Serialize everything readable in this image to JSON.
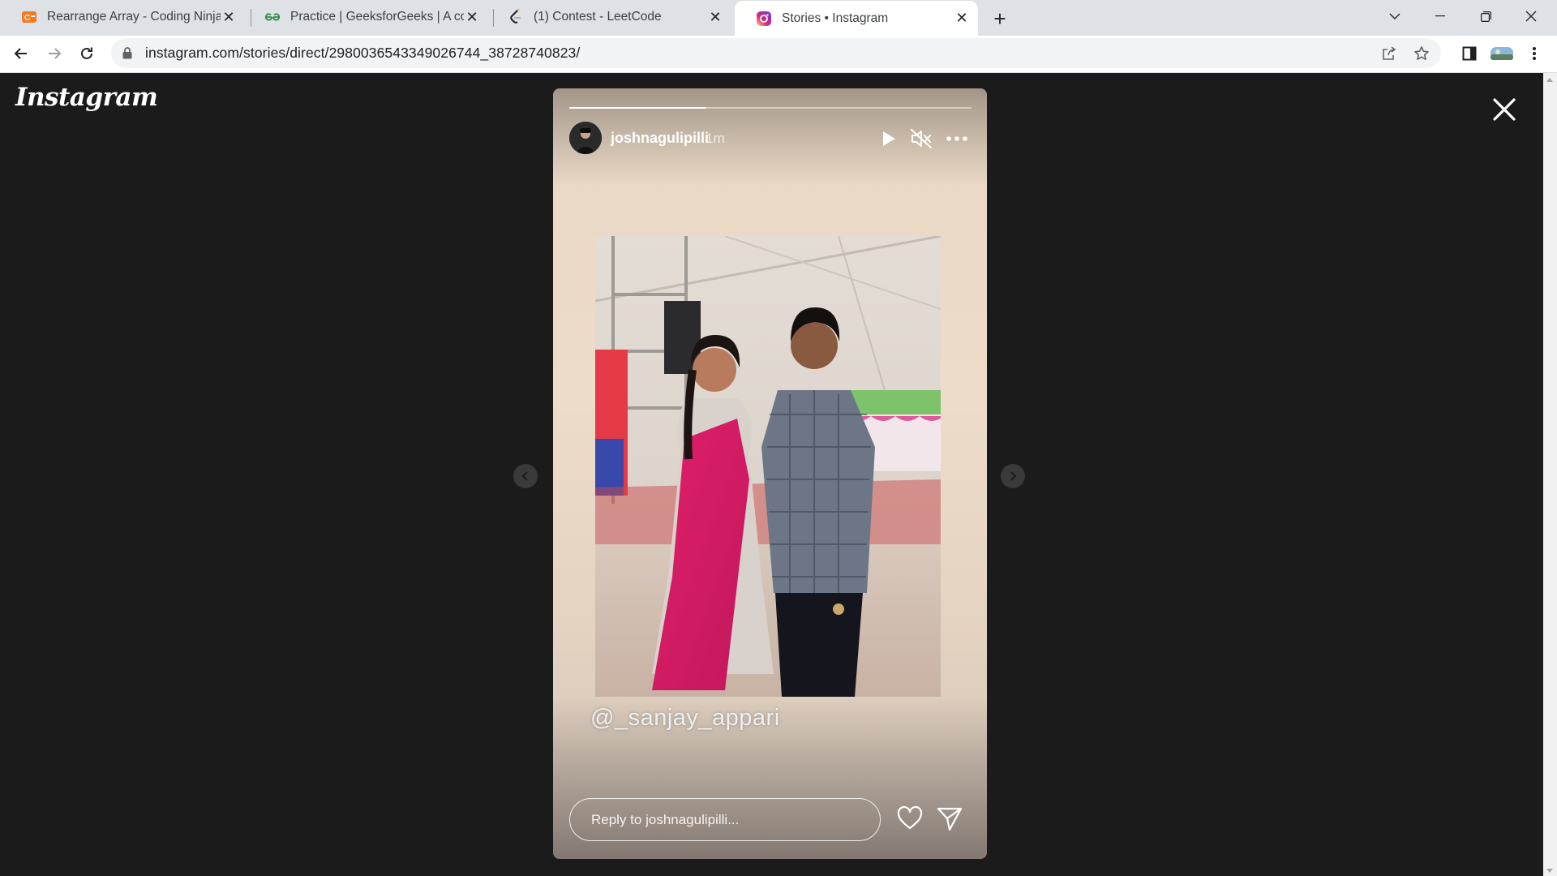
{
  "browser": {
    "tabs": [
      {
        "title": "Rearrange Array - Coding Ninjas",
        "favicon": "coding-ninjas-icon",
        "active": false
      },
      {
        "title": "Practice | GeeksforGeeks | A computer science portal",
        "favicon": "geeksforgeeks-icon",
        "active": false
      },
      {
        "title": "(1) Contest - LeetCode",
        "favicon": "leetcode-icon",
        "active": false
      },
      {
        "title": "Stories • Instagram",
        "favicon": "instagram-icon",
        "active": true
      }
    ],
    "url": "instagram.com/stories/direct/2980036543349026744_38728740823/"
  },
  "instagram": {
    "logo_text": "Instagram"
  },
  "story": {
    "username": "joshnagulipilli",
    "time": "1m",
    "progress": 0.34,
    "mention": "@_sanjay_appari",
    "reply_placeholder": "Reply to joshnagulipilli..."
  },
  "colors": {
    "background": "#1b1b1b",
    "instagram_gradient": [
      "#feda75",
      "#d62976",
      "#962fbf",
      "#4f5bd5"
    ]
  }
}
